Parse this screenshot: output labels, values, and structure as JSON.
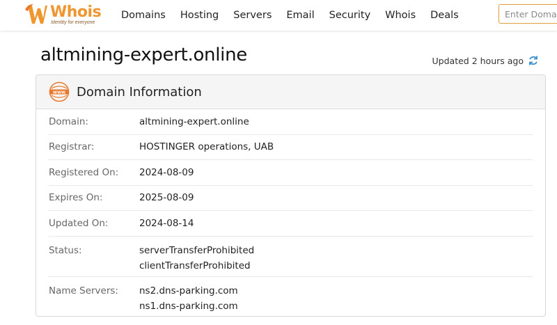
{
  "brand": {
    "name": "Whois",
    "tagline": "Identity for everyone",
    "accent_color": "#f09630"
  },
  "nav": {
    "items": [
      "Domains",
      "Hosting",
      "Servers",
      "Email",
      "Security",
      "Whois",
      "Deals"
    ]
  },
  "search": {
    "placeholder": "Enter Domain or IP"
  },
  "page": {
    "title": "altmining-expert.online",
    "updated": "Updated 2 hours ago"
  },
  "card": {
    "title": "Domain Information",
    "icon": "www-icon",
    "rows": [
      {
        "label": "Domain:",
        "values": [
          "altmining-expert.online"
        ]
      },
      {
        "label": "Registrar:",
        "values": [
          "HOSTINGER operations, UAB"
        ]
      },
      {
        "label": "Registered On:",
        "values": [
          "2024-08-09"
        ]
      },
      {
        "label": "Expires On:",
        "values": [
          "2025-08-09"
        ]
      },
      {
        "label": "Updated On:",
        "values": [
          "2024-08-14"
        ]
      },
      {
        "label": "Status:",
        "values": [
          "serverTransferProhibited",
          "clientTransferProhibited"
        ]
      },
      {
        "label": "Name Servers:",
        "values": [
          "ns2.dns-parking.com",
          "ns1.dns-parking.com"
        ]
      }
    ]
  }
}
